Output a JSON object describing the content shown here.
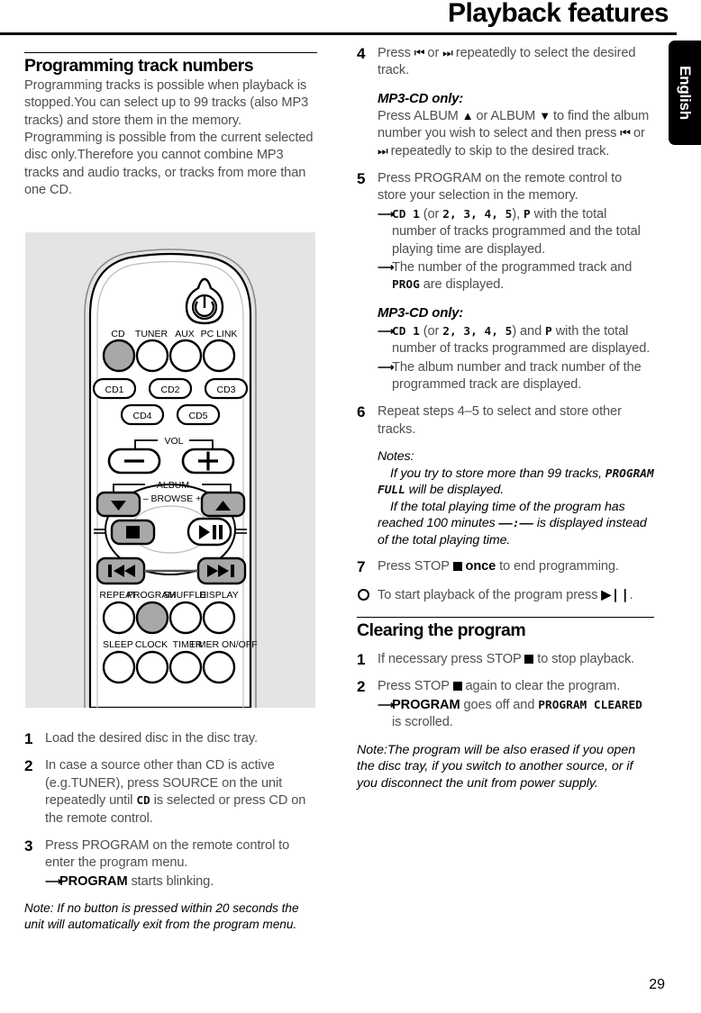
{
  "header": {
    "title": "Playback features",
    "language_tab": "English"
  },
  "page_number": "29",
  "left_column": {
    "section_title": "Programming track numbers",
    "intro": "Programming tracks is possible when playback is stopped.You can select up to 99 tracks (also MP3 tracks) and store them in the memory. Programming is possible from the current selected disc only.Therefore you cannot combine MP3 tracks and audio tracks, or tracks from more than one CD.",
    "steps": [
      {
        "num": "1",
        "text": "Load the desired disc in the disc tray."
      },
      {
        "num": "2",
        "text_a": "In case a source other than CD is active (e.g.TUNER), press SOURCE on the unit repeatedly until ",
        "lcd": "CD",
        "text_b": " is selected or press CD on the remote control."
      },
      {
        "num": "3",
        "text": "Press PROGRAM on the remote control to enter the program menu.",
        "arrow_bold": "PROGRAM",
        "arrow_rest": " starts blinking."
      }
    ],
    "note": "Note: If no button is pressed within 20 seconds the unit will automatically exit from the program menu."
  },
  "right_column": {
    "steps": [
      {
        "num": "4",
        "text_a": "Press ",
        "glyph_prev": "⏮",
        "text_b": " or ",
        "glyph_next": "⏭",
        "text_c": " repeatedly to select the desired track.",
        "mp3_head": "MP3-CD only:",
        "mp3_a": "Press ALBUM ",
        "mp3_up": "▲",
        "mp3_b": " or ALBUM ",
        "mp3_dn": "▼",
        "mp3_c": " to find the album number you wish to select and then press ",
        "mp3_d": " or ",
        "mp3_e": " repeatedly to skip to the desired track."
      },
      {
        "num": "5",
        "text": "Press PROGRAM on the remote control to store your selection in the memory.",
        "arrow1_lcd_a": "CD 1",
        "arrow1_mid": " (or ",
        "arrow1_lcd_b": "2, 3, 4, 5",
        "arrow1_mid2": "), ",
        "arrow1_lcd_c": "P",
        "arrow1_rest": " with the total number of tracks programmed and the total playing time are displayed.",
        "arrow2_a": "The number of the programmed track and ",
        "arrow2_lcd": "PROG",
        "arrow2_b": " are displayed.",
        "mp3_head": "MP3-CD only:",
        "mp3_arrow1_lcd_a": "CD 1",
        "mp3_arrow1_mid": " (or ",
        "mp3_arrow1_lcd_b": "2, 3, 4, 5",
        "mp3_arrow1_mid2": ") and ",
        "mp3_arrow1_lcd_c": "P",
        "mp3_arrow1_rest": " with the total number of tracks programmed are displayed.",
        "mp3_arrow2": "The album number and track number of the programmed track are displayed."
      },
      {
        "num": "6",
        "text": "Repeat steps 4–5 to select and store other tracks.",
        "notes_label": "Notes:",
        "note1_a": "If you try to store more than 99 tracks, ",
        "note1_lcd": "PROGRAM FULL",
        "note1_b": " will be displayed.",
        "note2_a": "If the total playing time of the program has reached 100 minutes ",
        "note2_lcd": "––:––",
        "note2_b": " is displayed instead of the total playing time."
      },
      {
        "num": "7",
        "text_a": "Press STOP ",
        "text_bold": "once",
        "text_b": " to end programming."
      },
      {
        "num": "○",
        "text_a": "To start playback of the program press ",
        "glyph": "▶❘❘",
        "text_b": "."
      }
    ],
    "clearing": {
      "section_title": "Clearing the program",
      "steps": [
        {
          "num": "1",
          "text_a": "If necessary press STOP ",
          "text_b": " to stop playback."
        },
        {
          "num": "2",
          "text_a": "Press STOP ",
          "text_b": " again to clear the program.",
          "arrow_bold": "PROGRAM",
          "arrow_mid": " goes off and ",
          "arrow_lcd": "PROGRAM CLEARED",
          "arrow_rest": " is scrolled."
        }
      ],
      "note": "Note:The program will be also erased if you open the disc tray, if you switch to another source, or if you disconnect the unit from power supply."
    }
  },
  "remote": {
    "power_icon": "power-icon",
    "source_buttons": [
      "CD",
      "TUNER",
      "AUX",
      "PC LINK"
    ],
    "disc_buttons_row1": [
      "CD1",
      "CD2",
      "CD3"
    ],
    "disc_buttons_row2": [
      "CD4",
      "CD5"
    ],
    "vol_label": "VOL",
    "vol_minus": "–",
    "vol_plus": "+",
    "album_label": "ALBUM",
    "browse_label": "– BROWSE +",
    "transport": {
      "stop": "■",
      "play_pause": "▶❙❙",
      "prev": "⏮",
      "next": "⏭",
      "album_down": "▼",
      "album_up": "▲"
    },
    "function_row1": [
      "REPEAT",
      "PROGRAM",
      "SHUFFLE",
      "DISPLAY"
    ],
    "function_row2": [
      "SLEEP",
      "CLOCK",
      "TIMER",
      "TIMER ON/OFF"
    ],
    "highlight_color": "#a8a8a8",
    "body_color": "#ffffff",
    "background_color": "#e4e4e4"
  }
}
